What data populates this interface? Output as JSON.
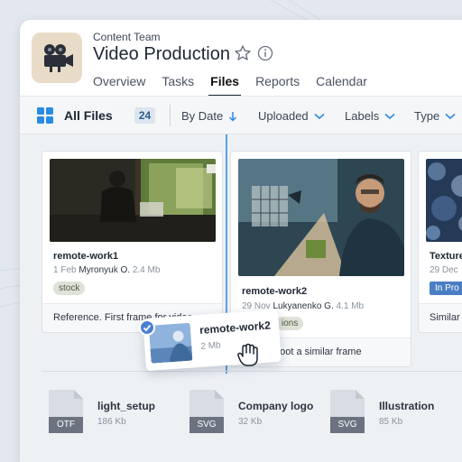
{
  "header": {
    "team": "Content Team",
    "title": "Video Production",
    "tabs": [
      {
        "label": "Overview",
        "active": false
      },
      {
        "label": "Tasks",
        "active": false
      },
      {
        "label": "Files",
        "active": true
      },
      {
        "label": "Reports",
        "active": false
      },
      {
        "label": "Calendar",
        "active": false
      }
    ]
  },
  "toolbar": {
    "all_files_label": "All Files",
    "count": "24",
    "filters": [
      "By Date",
      "Uploaded",
      "Labels",
      "Type"
    ]
  },
  "cards": [
    {
      "name": "remote-work1",
      "date": "1 Feb",
      "author": "Myronyuk O.",
      "size": "2.4 Mb",
      "tag": "stock",
      "note": "Reference. First frame for video"
    },
    {
      "name": "remote-work2",
      "date": "29 Nov",
      "author": "Lukyanenko G.",
      "size": "4.1 Mb",
      "tag": "ions",
      "note": "hoot a similar frame"
    },
    {
      "name": "Texture",
      "date": "29 Dec",
      "tag": "In Pro",
      "note": "Similar"
    }
  ],
  "drag": {
    "name": "remote-work2",
    "size": "2 Mb"
  },
  "files": [
    {
      "name": "light_setup",
      "size": "186 Kb",
      "type": "OTF"
    },
    {
      "name": "Company logo",
      "size": "32 Kb",
      "type": "SVG"
    },
    {
      "name": "Illustration",
      "size": "85 Kb",
      "type": "SVG"
    }
  ],
  "colors": {
    "accent": "#2b8ae2",
    "file_icon_dark": "#6b7380",
    "file_icon_light": "#d8dde3"
  },
  "icons": [
    "camera-icon",
    "star-icon",
    "info-icon",
    "grid-icon",
    "arrow-down-icon",
    "chevron-down-icon",
    "check-icon",
    "hand-cursor-icon"
  ]
}
